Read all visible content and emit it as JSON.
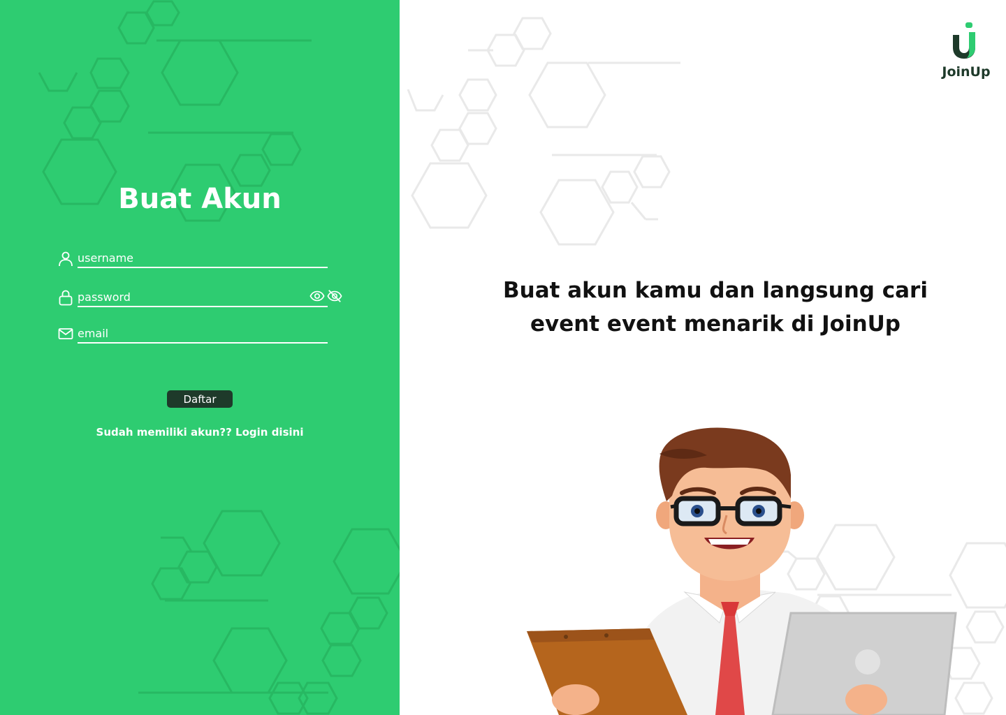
{
  "form": {
    "title": "Buat Akun",
    "username_placeholder": "username",
    "password_placeholder": "password",
    "email_placeholder": "email",
    "submit_label": "Daftar",
    "login_link": "Sudah memiliki akun?? Login disini"
  },
  "brand": {
    "name": "JoinUp",
    "primary_color": "#2ecc71",
    "dark_color": "#1e3a2a"
  },
  "hero": {
    "line1": "Buat akun kamu dan langsung cari",
    "line2": "event event menarik di JoinUp"
  },
  "icons": {
    "username": "user-icon",
    "password": "lock-icon",
    "email": "mail-icon",
    "show": "eye-icon",
    "hide": "eye-off-icon"
  }
}
